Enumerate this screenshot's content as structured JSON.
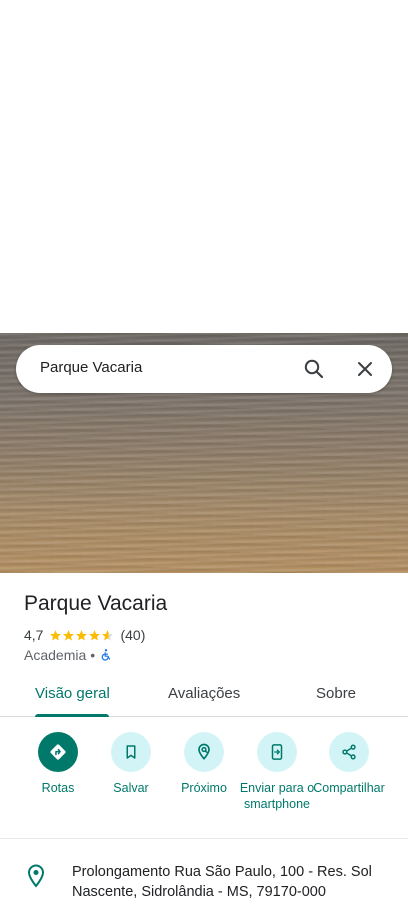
{
  "search": {
    "query": "Parque Vacaria"
  },
  "place": {
    "title": "Parque Vacaria",
    "rating": "4,7",
    "rating_stars": 4.7,
    "review_count": "(40)",
    "category": "Academia",
    "separator": "•"
  },
  "tabs": [
    {
      "label": "Visão geral",
      "active": true
    },
    {
      "label": "Avaliações",
      "active": false
    },
    {
      "label": "Sobre",
      "active": false
    }
  ],
  "actions": [
    {
      "label": "Rotas",
      "icon": "directions-icon"
    },
    {
      "label": "Salvar",
      "icon": "bookmark-icon"
    },
    {
      "label": "Próximo",
      "icon": "nearby-icon"
    },
    {
      "label": "Enviar para o smartphone",
      "icon": "send-to-phone-icon"
    },
    {
      "label": "Compartilhar",
      "icon": "share-icon"
    }
  ],
  "address": {
    "line1": "Prolongamento Rua São Paulo, 100 - Res. Sol",
    "line2": "Nascente, Sidrolândia - MS, 79170-000"
  },
  "colors": {
    "accent": "#00796b",
    "action_bg": "#d3f4f7",
    "star": "#fbbc04"
  }
}
